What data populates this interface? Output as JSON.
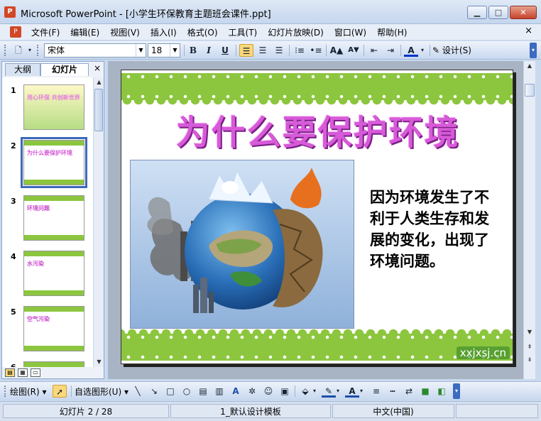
{
  "window": {
    "title": "Microsoft PowerPoint - [小学生环保教育主题班会课件.ppt]",
    "app_icon": "powerpoint-icon",
    "controls": [
      "minimize-icon",
      "maximize-icon",
      "close-icon"
    ]
  },
  "menu": {
    "items": [
      "文件(F)",
      "编辑(E)",
      "视图(V)",
      "插入(I)",
      "格式(O)",
      "工具(T)",
      "幻灯片放映(D)",
      "窗口(W)",
      "帮助(H)"
    ],
    "close_glyph": "×"
  },
  "format_toolbar": {
    "font_name": "宋体",
    "font_size": "18",
    "bold": "B",
    "italic": "I",
    "underline": "U",
    "design_label": "设计(S)"
  },
  "left_panel": {
    "tabs": [
      "大纲",
      "幻灯片"
    ],
    "active_tab": "幻灯片",
    "close_glyph": "×",
    "slides": [
      {
        "number": "1",
        "text": "用心环保 共创新世界"
      },
      {
        "number": "2",
        "text": "为什么要保护环境"
      },
      {
        "number": "3",
        "text": "环境问题"
      },
      {
        "number": "4",
        "text": "水污染"
      },
      {
        "number": "5",
        "text": "空气污染"
      },
      {
        "number": "6",
        "text": ""
      }
    ],
    "selected_slide": 2
  },
  "slide": {
    "title": "为什么要保护环境",
    "body": "因为环境发生了不利于人类生存和发展的变化，出现了环境问题。",
    "watermark": "xxjxsj.cn",
    "band_color": "#8cc63f",
    "title_color": "#d75ad8"
  },
  "draw_toolbar": {
    "draw_label": "绘图(R)",
    "autoshapes_label": "自选图形(U)"
  },
  "status": {
    "slide_position": "幻灯片 2 / 28",
    "design_template": "1_默认设计模板",
    "language": "中文(中国)"
  }
}
